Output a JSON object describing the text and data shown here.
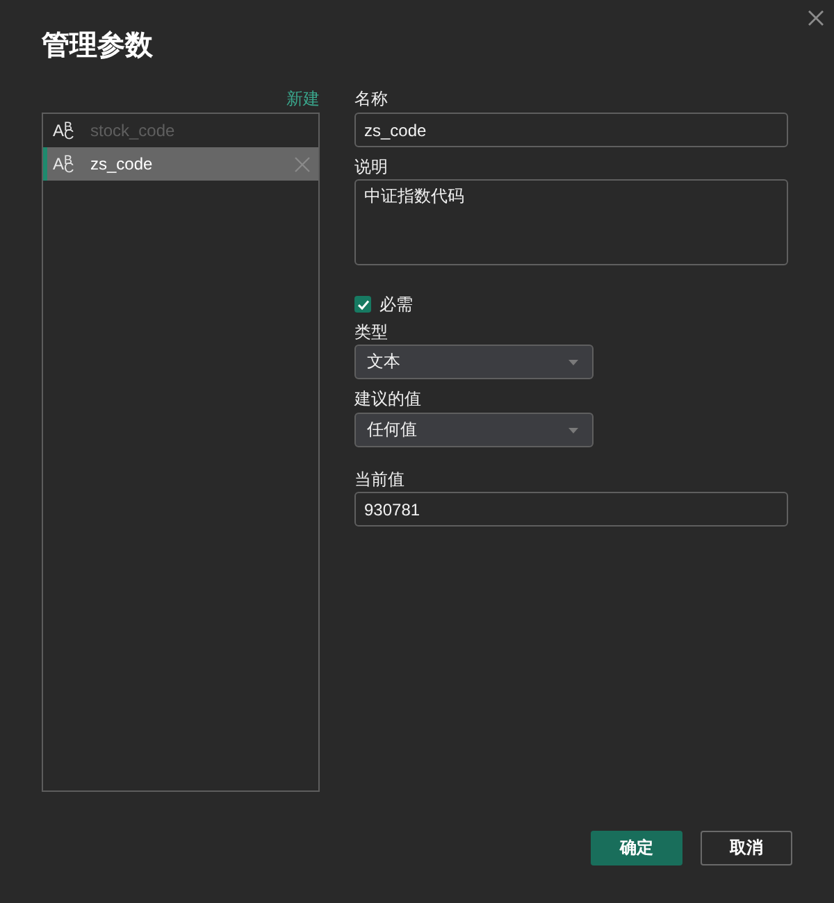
{
  "window": {
    "title": "管理参数"
  },
  "new_link": "新建",
  "parameters": [
    {
      "type_label": "A$^{B}$$_{C}$",
      "name": "stock_code",
      "selected": false
    },
    {
      "type_label": "A$^{B}$$_{C}$",
      "name": "zs_code",
      "selected": true
    }
  ],
  "form": {
    "name": {
      "label": "名称",
      "value": "zs_code"
    },
    "description": {
      "label": "说明",
      "value": "中证指数代码"
    },
    "required": {
      "label": "必需",
      "checked": true
    },
    "type": {
      "label": "类型",
      "value": "文本"
    },
    "suggested": {
      "label": "建议的值",
      "value": "任何值"
    },
    "current": {
      "label": "当前值",
      "value": "930781"
    }
  },
  "buttons": [
    {
      "label": "确定",
      "kind": "primary"
    },
    {
      "label": "取消",
      "kind": "secondary"
    }
  ]
}
